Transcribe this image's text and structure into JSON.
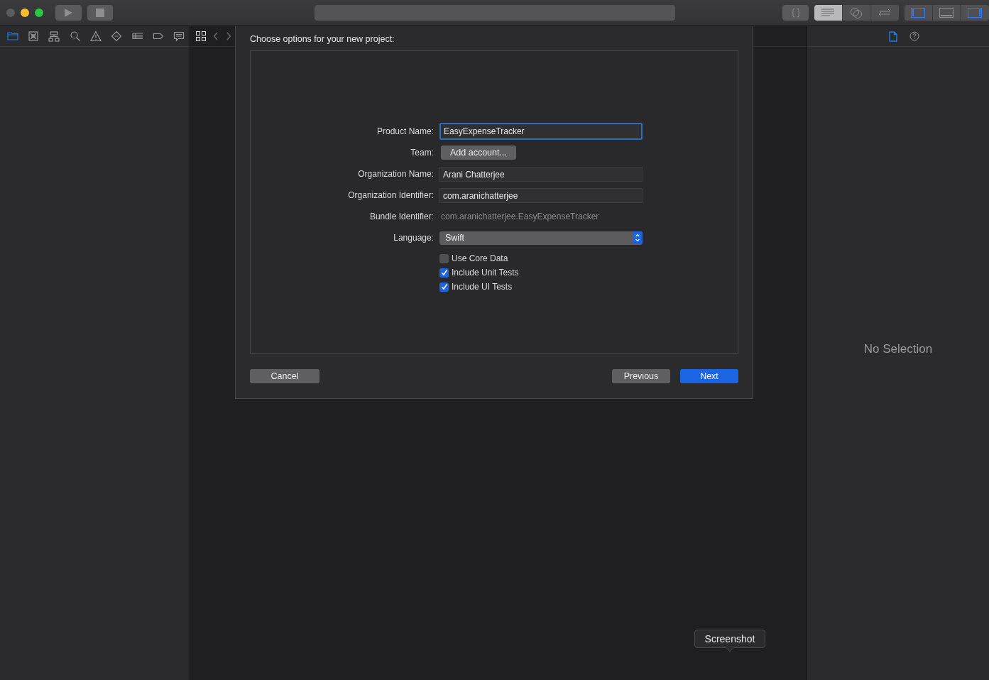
{
  "toolbar": {
    "editor_modes": [
      {
        "kind": "standard",
        "selected": true
      },
      {
        "kind": "assistant",
        "selected": false
      },
      {
        "kind": "version",
        "selected": false
      }
    ],
    "panels": [
      {
        "kind": "left",
        "on": true
      },
      {
        "kind": "bottom",
        "on": false
      },
      {
        "kind": "right",
        "on": true
      }
    ]
  },
  "navigator": {
    "tabs": [
      {
        "kind": "folder",
        "selected": true
      },
      {
        "kind": "source",
        "selected": false
      },
      {
        "kind": "hierarchy",
        "selected": false
      },
      {
        "kind": "search",
        "selected": false
      },
      {
        "kind": "warning",
        "selected": false
      },
      {
        "kind": "test",
        "selected": false
      },
      {
        "kind": "debug",
        "selected": false
      },
      {
        "kind": "breakpoint",
        "selected": false
      },
      {
        "kind": "report",
        "selected": false
      }
    ]
  },
  "dialog": {
    "title": "Choose options for your new project:",
    "fields": [
      {
        "kind": "input",
        "label": "Product Name:",
        "value": "EasyExpenseTracker",
        "focused": true
      },
      {
        "kind": "button",
        "label": "Team:",
        "value": "Add account..."
      },
      {
        "kind": "input",
        "label": "Organization Name:",
        "value": "Arani Chatterjee",
        "focused": false
      },
      {
        "kind": "input",
        "label": "Organization Identifier:",
        "value": "com.aranichatterjee",
        "focused": false
      },
      {
        "kind": "static",
        "label": "Bundle Identifier:",
        "value": "com.aranichatterjee.EasyExpenseTracker"
      },
      {
        "kind": "popup",
        "label": "Language:",
        "value": "Swift"
      }
    ],
    "options": [
      {
        "label": "Use Core Data",
        "checked": false
      },
      {
        "label": "Include Unit Tests",
        "checked": true
      },
      {
        "label": "Include UI Tests",
        "checked": true
      }
    ],
    "buttons": {
      "cancel": "Cancel",
      "previous": "Previous",
      "next": "Next"
    }
  },
  "inspector": {
    "tabs": [
      {
        "kind": "file",
        "selected": true
      },
      {
        "kind": "help",
        "selected": false
      }
    ],
    "empty_text": "No Selection"
  },
  "tooltip": "Screenshot"
}
